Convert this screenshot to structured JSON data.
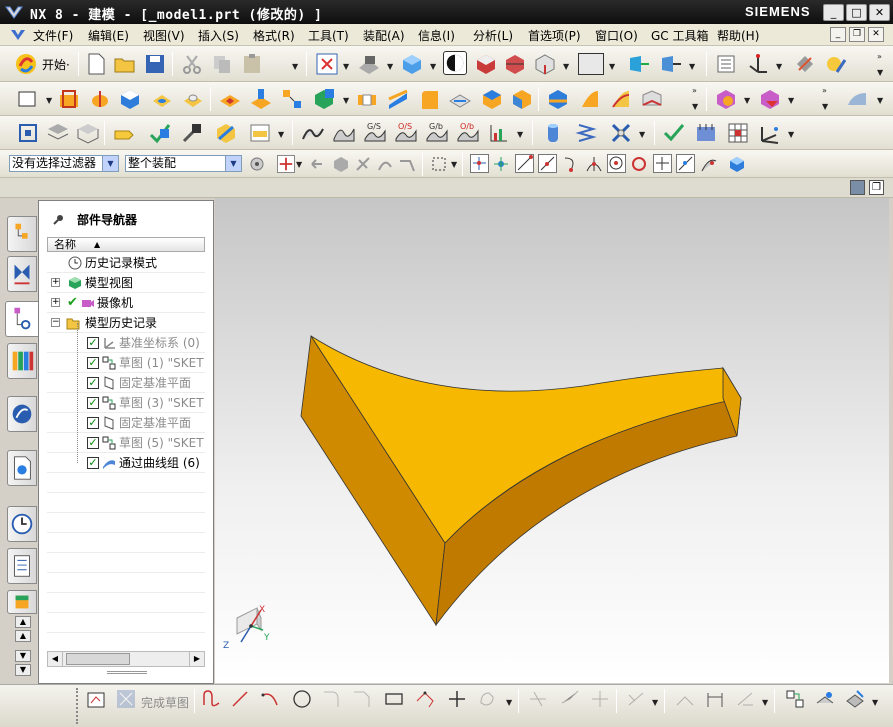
{
  "window": {
    "title": "NX 8 - 建模 - [_model1.prt (修改的) ]",
    "brand": "SIEMENS",
    "controls": [
      "_",
      "□",
      "✕"
    ]
  },
  "menubar": {
    "items": [
      "文件(F)",
      "编辑(E)",
      "视图(V)",
      "插入(S)",
      "格式(R)",
      "工具(T)",
      "装配(A)",
      "信息(I)",
      "分析(L)",
      "首选项(P)",
      "窗口(O)",
      "GC 工具箱",
      "帮助(H)"
    ],
    "start_label": "开始·"
  },
  "selection_bar": {
    "filter_value": "没有选择过滤器",
    "scope_value": "整个装配"
  },
  "navigator": {
    "title": "部件导航器",
    "column_header": "名称",
    "items": [
      {
        "label": "历史记录模式",
        "state": "normal"
      },
      {
        "label": "模型视图",
        "state": "normal"
      },
      {
        "label": "摄像机",
        "state": "normal"
      },
      {
        "label": "模型历史记录",
        "state": "normal"
      },
      {
        "label": "基准坐标系 (0)",
        "state": "suppressed"
      },
      {
        "label": "草图 (1) \"SKET",
        "state": "suppressed"
      },
      {
        "label": "固定基准平面",
        "state": "suppressed"
      },
      {
        "label": "草图 (3) \"SKET",
        "state": "suppressed"
      },
      {
        "label": "固定基准平面",
        "state": "suppressed"
      },
      {
        "label": "草图 (5) \"SKET",
        "state": "suppressed"
      },
      {
        "label": "通过曲线组 (6)",
        "state": "active"
      }
    ]
  },
  "viewport": {
    "axis_labels": {
      "x": "X",
      "y": "Y",
      "z": "Z"
    },
    "model_color": "#f5b800",
    "model_shadow": "#cc8800"
  },
  "sketch_toolbar": {
    "finish_sketch": "完成草图"
  },
  "icons": [
    "nx-logo-icon",
    "new-file-icon",
    "open-folder-icon",
    "save-icon",
    "cut-icon",
    "copy-icon",
    "paste-icon",
    "fit-icon",
    "render-style-icon",
    "orient-view-icon",
    "extrude-icon",
    "block-icon",
    "cylinder-icon",
    "boolean-icon",
    "sketch-icon",
    "datum-plane-icon"
  ]
}
